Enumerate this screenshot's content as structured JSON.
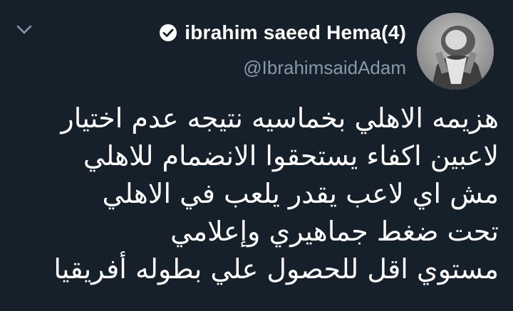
{
  "tweet": {
    "author": {
      "display_name": "ibrahim saeed Hema(4)",
      "handle": "@IbrahimsaidAdam",
      "verified_icon": "verified-badge-icon",
      "avatar_icon": "user-avatar-photo"
    },
    "menu_icon": "chevron-down-icon",
    "text_lines": [
      "هزيمه الاهلي بخماسيه نتيجه عدم اختيار",
      "لاعبين  اكفاء يستحقوا الانضمام للاهلي",
      "مش اي لاعب يقدر يلعب في الاهلي",
      "تحت ضغط جماهيري وإعلامي",
      "مستوي اقل للحصول علي بطوله أفريقيا"
    ]
  },
  "colors": {
    "background": "#15202b",
    "text_primary": "#ffffff",
    "text_secondary": "#8899a6",
    "icon_muted": "#8899a6"
  }
}
